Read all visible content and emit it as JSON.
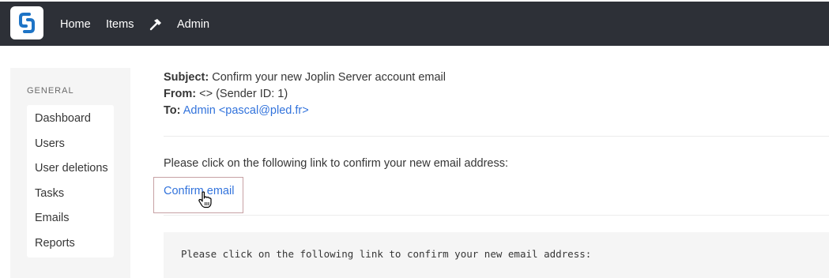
{
  "nav": {
    "items": [
      "Home",
      "Items",
      "Admin"
    ],
    "admin_icon": "hammer-icon",
    "logo_icon": "joplin-logo-icon"
  },
  "sidebar": {
    "heading": "GENERAL",
    "items": [
      "Dashboard",
      "Users",
      "User deletions",
      "Tasks",
      "Emails",
      "Reports"
    ]
  },
  "email": {
    "subject_label": "Subject:",
    "subject": "Confirm your new Joplin Server account email",
    "from_label": "From:",
    "from": "<> (Sender ID: 1)",
    "to_label": "To:",
    "to": "Admin <pascal@pled.fr>",
    "body_text": "Please click on the following link to confirm your new email address:",
    "confirm_link": "Confirm email",
    "plain_text": "Please click on the following link to confirm your new email address:"
  },
  "colors": {
    "topbar": "#2d3037",
    "link": "#3273dc",
    "sidebar_bg": "#f5f5f5",
    "focus_outline": "#c7a1a4"
  }
}
